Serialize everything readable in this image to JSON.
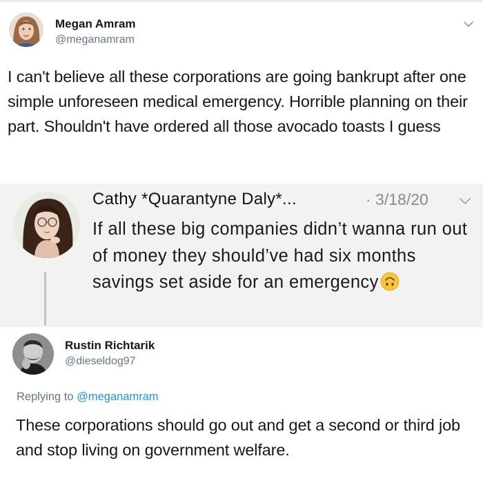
{
  "tweet": {
    "author_name": "Megan Amram",
    "author_handle": "@meganamram",
    "text": "I can't believe all these corporations are going bankrupt after one simple unforeseen medical emergency. Horrible planning on their part. Shouldn't have ordered all those avocado toasts I guess",
    "menu_icon": "chevron-down-icon"
  },
  "quoted_reply": {
    "author_name": "Cathy *Quarantyne Daly*...",
    "date": "· 3/18/20",
    "text": "If all these big companies didn’t wanna run out of money they should’ve had six months savings set aside for an emergency",
    "emoji": "upside-down-face-emoji",
    "menu_icon": "chevron-down-icon"
  },
  "reply": {
    "author_name": "Rustin Richtarik",
    "author_handle": "@dieseldog97",
    "replying_prefix": "Replying to ",
    "replying_to": "@meganamram",
    "text": "These corporations should go out and get a second or third job and stop living on government welfare."
  },
  "colors": {
    "mention": "#1b95e0",
    "secondary_text": "#657786",
    "quote_background": "#f2f2f2"
  }
}
